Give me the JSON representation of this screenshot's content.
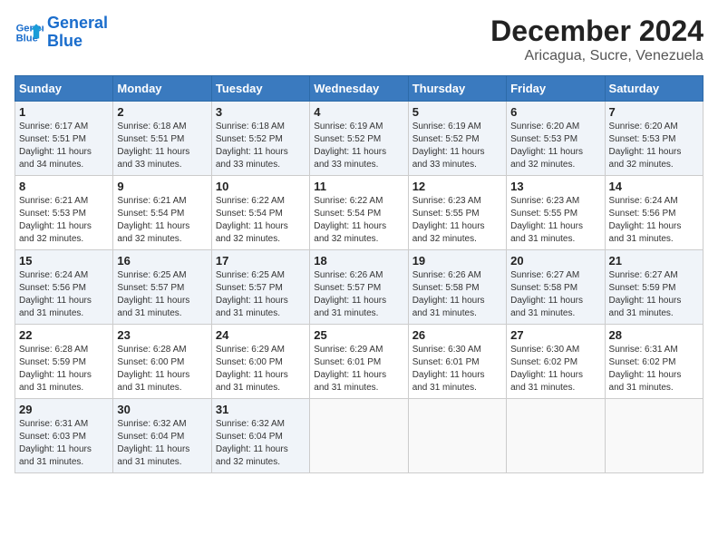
{
  "header": {
    "logo_line1": "General",
    "logo_line2": "Blue",
    "title": "December 2024",
    "subtitle": "Aricagua, Sucre, Venezuela"
  },
  "calendar": {
    "weekdays": [
      "Sunday",
      "Monday",
      "Tuesday",
      "Wednesday",
      "Thursday",
      "Friday",
      "Saturday"
    ],
    "weeks": [
      [
        {
          "day": "1",
          "info": "Sunrise: 6:17 AM\nSunset: 5:51 PM\nDaylight: 11 hours\nand 34 minutes."
        },
        {
          "day": "2",
          "info": "Sunrise: 6:18 AM\nSunset: 5:51 PM\nDaylight: 11 hours\nand 33 minutes."
        },
        {
          "day": "3",
          "info": "Sunrise: 6:18 AM\nSunset: 5:52 PM\nDaylight: 11 hours\nand 33 minutes."
        },
        {
          "day": "4",
          "info": "Sunrise: 6:19 AM\nSunset: 5:52 PM\nDaylight: 11 hours\nand 33 minutes."
        },
        {
          "day": "5",
          "info": "Sunrise: 6:19 AM\nSunset: 5:52 PM\nDaylight: 11 hours\nand 33 minutes."
        },
        {
          "day": "6",
          "info": "Sunrise: 6:20 AM\nSunset: 5:53 PM\nDaylight: 11 hours\nand 32 minutes."
        },
        {
          "day": "7",
          "info": "Sunrise: 6:20 AM\nSunset: 5:53 PM\nDaylight: 11 hours\nand 32 minutes."
        }
      ],
      [
        {
          "day": "8",
          "info": "Sunrise: 6:21 AM\nSunset: 5:53 PM\nDaylight: 11 hours\nand 32 minutes."
        },
        {
          "day": "9",
          "info": "Sunrise: 6:21 AM\nSunset: 5:54 PM\nDaylight: 11 hours\nand 32 minutes."
        },
        {
          "day": "10",
          "info": "Sunrise: 6:22 AM\nSunset: 5:54 PM\nDaylight: 11 hours\nand 32 minutes."
        },
        {
          "day": "11",
          "info": "Sunrise: 6:22 AM\nSunset: 5:54 PM\nDaylight: 11 hours\nand 32 minutes."
        },
        {
          "day": "12",
          "info": "Sunrise: 6:23 AM\nSunset: 5:55 PM\nDaylight: 11 hours\nand 32 minutes."
        },
        {
          "day": "13",
          "info": "Sunrise: 6:23 AM\nSunset: 5:55 PM\nDaylight: 11 hours\nand 31 minutes."
        },
        {
          "day": "14",
          "info": "Sunrise: 6:24 AM\nSunset: 5:56 PM\nDaylight: 11 hours\nand 31 minutes."
        }
      ],
      [
        {
          "day": "15",
          "info": "Sunrise: 6:24 AM\nSunset: 5:56 PM\nDaylight: 11 hours\nand 31 minutes."
        },
        {
          "day": "16",
          "info": "Sunrise: 6:25 AM\nSunset: 5:57 PM\nDaylight: 11 hours\nand 31 minutes."
        },
        {
          "day": "17",
          "info": "Sunrise: 6:25 AM\nSunset: 5:57 PM\nDaylight: 11 hours\nand 31 minutes."
        },
        {
          "day": "18",
          "info": "Sunrise: 6:26 AM\nSunset: 5:57 PM\nDaylight: 11 hours\nand 31 minutes."
        },
        {
          "day": "19",
          "info": "Sunrise: 6:26 AM\nSunset: 5:58 PM\nDaylight: 11 hours\nand 31 minutes."
        },
        {
          "day": "20",
          "info": "Sunrise: 6:27 AM\nSunset: 5:58 PM\nDaylight: 11 hours\nand 31 minutes."
        },
        {
          "day": "21",
          "info": "Sunrise: 6:27 AM\nSunset: 5:59 PM\nDaylight: 11 hours\nand 31 minutes."
        }
      ],
      [
        {
          "day": "22",
          "info": "Sunrise: 6:28 AM\nSunset: 5:59 PM\nDaylight: 11 hours\nand 31 minutes."
        },
        {
          "day": "23",
          "info": "Sunrise: 6:28 AM\nSunset: 6:00 PM\nDaylight: 11 hours\nand 31 minutes."
        },
        {
          "day": "24",
          "info": "Sunrise: 6:29 AM\nSunset: 6:00 PM\nDaylight: 11 hours\nand 31 minutes."
        },
        {
          "day": "25",
          "info": "Sunrise: 6:29 AM\nSunset: 6:01 PM\nDaylight: 11 hours\nand 31 minutes."
        },
        {
          "day": "26",
          "info": "Sunrise: 6:30 AM\nSunset: 6:01 PM\nDaylight: 11 hours\nand 31 minutes."
        },
        {
          "day": "27",
          "info": "Sunrise: 6:30 AM\nSunset: 6:02 PM\nDaylight: 11 hours\nand 31 minutes."
        },
        {
          "day": "28",
          "info": "Sunrise: 6:31 AM\nSunset: 6:02 PM\nDaylight: 11 hours\nand 31 minutes."
        }
      ],
      [
        {
          "day": "29",
          "info": "Sunrise: 6:31 AM\nSunset: 6:03 PM\nDaylight: 11 hours\nand 31 minutes."
        },
        {
          "day": "30",
          "info": "Sunrise: 6:32 AM\nSunset: 6:04 PM\nDaylight: 11 hours\nand 31 minutes."
        },
        {
          "day": "31",
          "info": "Sunrise: 6:32 AM\nSunset: 6:04 PM\nDaylight: 11 hours\nand 32 minutes."
        },
        {
          "day": "",
          "info": ""
        },
        {
          "day": "",
          "info": ""
        },
        {
          "day": "",
          "info": ""
        },
        {
          "day": "",
          "info": ""
        }
      ]
    ]
  }
}
